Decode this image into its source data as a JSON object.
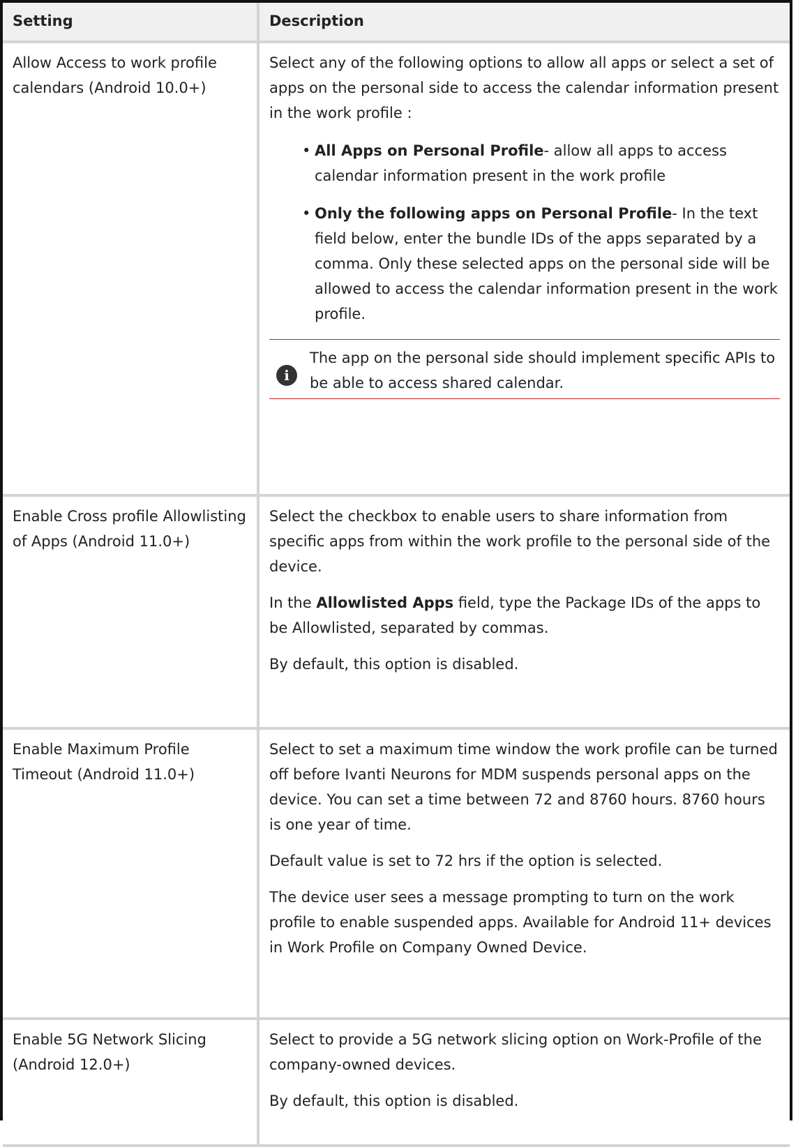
{
  "table": {
    "headers": [
      "Setting",
      "Description"
    ],
    "rows": [
      {
        "setting": "Allow Access to work profile calendars (Android 10.0+)",
        "intro": "Select any of the following options to allow all apps or select a set of apps on the personal side to access the calendar information present in the work profile :",
        "bullets": [
          {
            "bold": "All Apps on Personal Profile",
            "text": "- allow all apps to access calendar information present in the work profile"
          },
          {
            "bold": "Only the following apps on Personal Profile",
            "text": "- In the text field below, enter the bundle IDs of the apps separated by a comma. Only these selected apps on the personal side will be allowed to access the calendar information present in the work profile."
          }
        ],
        "note": "The app on the personal side should implement specific APIs to be able to access shared calendar."
      },
      {
        "setting": "Enable Cross profile Allowlisting of Apps (Android 11.0+)",
        "p1": "Select the checkbox to enable users to share information from specific apps from within the work profile to the personal side of the device.",
        "p2_pre": "In the ",
        "p2_bold": "Allowlisted Apps",
        "p2_post": " field, type the Package IDs of the apps to be Allowlisted, separated by commas.",
        "p3": "By default, this option is disabled."
      },
      {
        "setting": "Enable Maximum Profile Timeout (Android 11.0+)",
        "p1": "Select to set a maximum time window the work profile can be turned off before Ivanti Neurons for MDM suspends personal apps on the device. You can set a time between 72 and 8760 hours. 8760 hours is one year of time.",
        "p2": "Default value is set to 72 hrs if the option is selected.",
        "p3": "The device user sees a message prompting to turn on the work profile to enable suspended apps. Available for Android 11+ devices in Work Profile on Company Owned Device."
      },
      {
        "setting": "Enable 5G Network Slicing (Android 12.0+)",
        "p1": "Select to provide a 5G network slicing option on Work-Profile of the company-owned devices.",
        "p2": "By default, this option is disabled."
      }
    ]
  }
}
